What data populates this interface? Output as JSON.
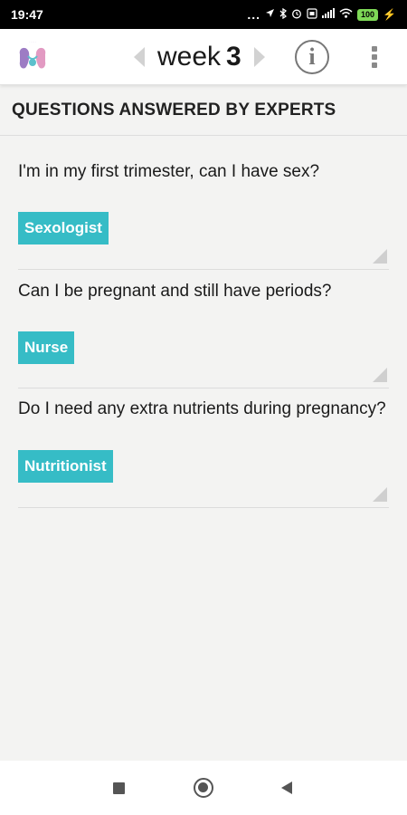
{
  "status_bar": {
    "time": "19:47",
    "dots": "...",
    "icons": [
      "location-icon",
      "bluetooth-icon",
      "alarm-icon",
      "sim-icon",
      "signal-icon",
      "wifi-icon",
      "battery-icon",
      "charging-icon"
    ],
    "battery": "100"
  },
  "header": {
    "logo_icon": "baby-feet-logo",
    "week_label": "week",
    "week_number": "3",
    "info_symbol": "i"
  },
  "section": {
    "title": "QUESTIONS ANSWERED BY EXPERTS"
  },
  "questions": [
    {
      "question": "I'm in my first trimester, can I have sex?",
      "expert": "Sexologist"
    },
    {
      "question": "Can I be pregnant and still have periods?",
      "expert": "Nurse"
    },
    {
      "question": "Do I need any extra nutrients during pregnancy?",
      "expert": "Nutritionist"
    }
  ],
  "colors": {
    "tag_background": "#36bcc6",
    "background": "#f3f3f2",
    "header_background": "#ffffff"
  }
}
